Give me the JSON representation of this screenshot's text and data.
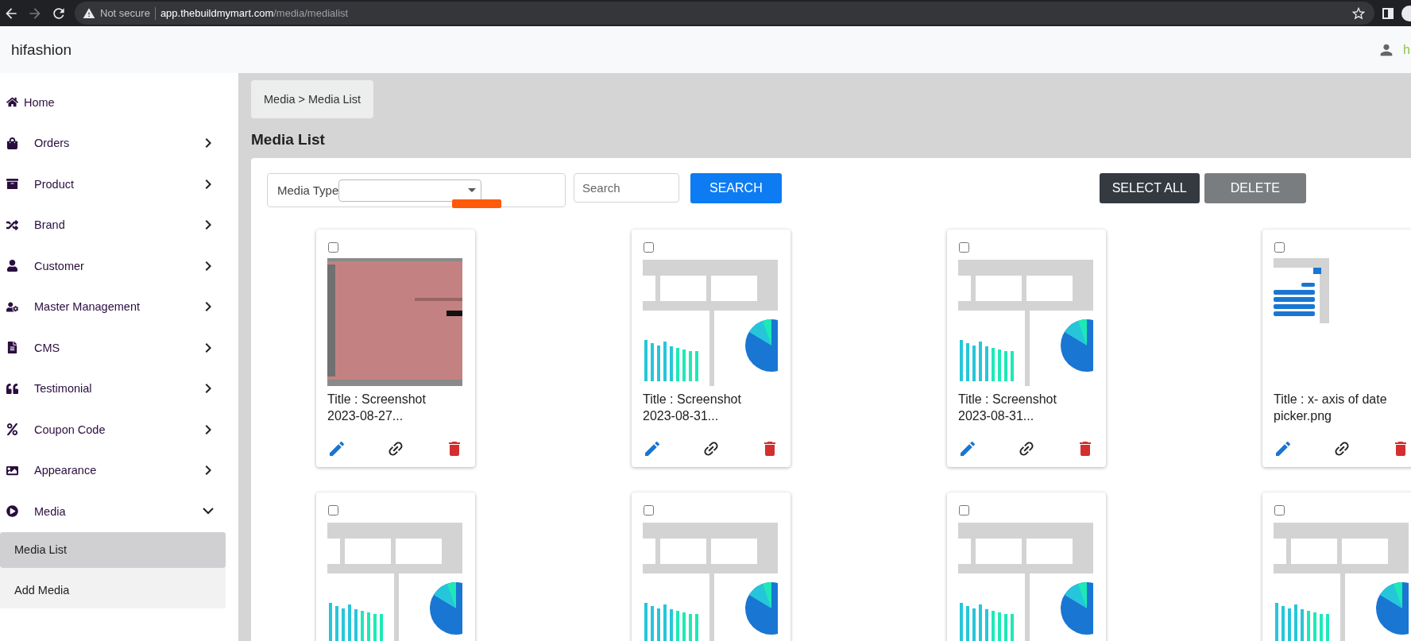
{
  "browser": {
    "security": "Not secure",
    "url": "**app.thebuildmymart.com**/media/medialist"
  },
  "header": {
    "brand": "hifashion",
    "user_name": "h"
  },
  "sidebar": {
    "items": [
      {
        "label": "Home",
        "kind": "link"
      },
      {
        "label": "Orders",
        "kind": "group",
        "expanded": false
      },
      {
        "label": "Product",
        "kind": "group",
        "expanded": false
      },
      {
        "label": "Brand",
        "kind": "group",
        "expanded": false
      },
      {
        "label": "Customer",
        "kind": "group",
        "expanded": false
      },
      {
        "label": "Master Management",
        "kind": "group",
        "expanded": false
      },
      {
        "label": "CMS",
        "kind": "group",
        "expanded": false
      },
      {
        "label": "Testimonial",
        "kind": "group",
        "expanded": false
      },
      {
        "label": "Coupon Code",
        "kind": "group",
        "expanded": false
      },
      {
        "label": "Appearance",
        "kind": "group",
        "expanded": false
      },
      {
        "label": "Media",
        "kind": "group",
        "expanded": true,
        "children": [
          {
            "label": "Media List",
            "selected": true
          },
          {
            "label": "Add Media",
            "selected": false
          }
        ]
      }
    ]
  },
  "breadcrumb": "Media > Media List",
  "page_title": "Media List",
  "filters": {
    "media_type_label": "Media Type",
    "search_placeholder": "Search",
    "search_button": "SEARCH",
    "select_all_button": "SELECT ALL",
    "delete_button": "DELETE"
  },
  "cards": [
    {
      "title": "Title : Screenshot 2023-08-27...",
      "checked": false
    },
    {
      "title": "Title : Screenshot 2023-08-31...",
      "checked": false
    },
    {
      "title": "Title : Screenshot 2023-08-31...",
      "checked": false
    },
    {
      "title": "Title : x- axis of date picker.png",
      "checked": false
    },
    {
      "checked": false
    },
    {
      "checked": false
    },
    {
      "checked": false
    },
    {
      "checked": false
    }
  ]
}
